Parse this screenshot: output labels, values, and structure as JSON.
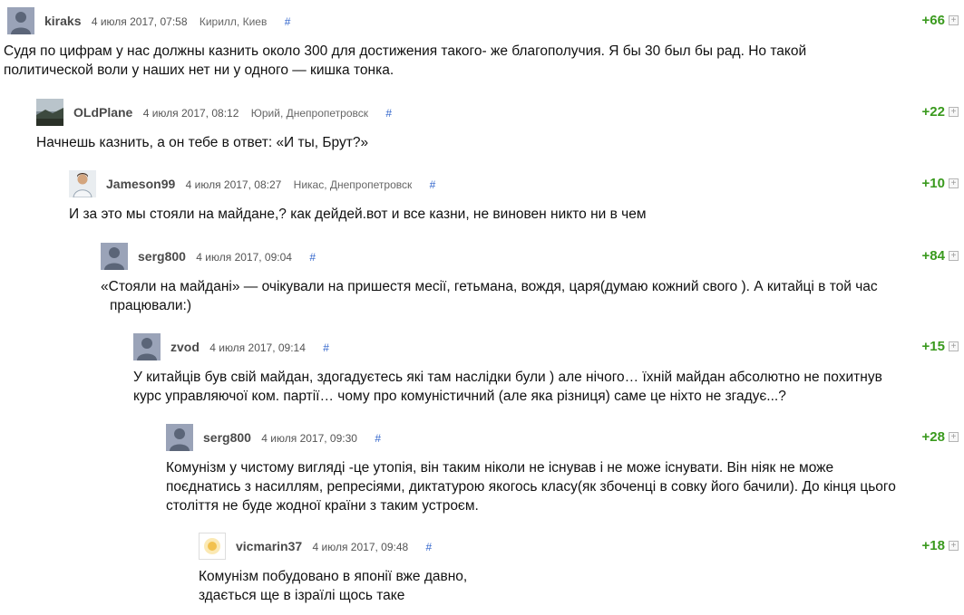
{
  "comments": [
    {
      "author": "kiraks",
      "date": "4 июля 2017, 07:58",
      "location": "Кирилл, Киев",
      "anchor": "#",
      "rating": "+66",
      "vote": "+",
      "avatar_icon": "default-user-avatar",
      "lines": [
        "Судя по цифрам у нас должны казнить около 300 для достижения такого- же благополучия. Я бы 30 был бы рад. Но такой",
        "политической воли у наших нет ни у одного — кишка тонка."
      ]
    },
    {
      "author": "OLdPlane",
      "date": "4 июля 2017, 08:12",
      "location": "Юрий, Днепропетровск",
      "anchor": "#",
      "rating": "+22",
      "vote": "+",
      "avatar_icon": "landscape-photo-avatar",
      "lines": [
        "Начнешь казнить, а он тебе в ответ: «И ты, Брут?»"
      ]
    },
    {
      "author": "Jameson99",
      "date": "4 июля 2017, 08:27",
      "location": "Никас, Днепропетровск",
      "anchor": "#",
      "rating": "+10",
      "vote": "+",
      "avatar_icon": "person-photo-avatar",
      "lines": [
        "И за это мы стояли на майдане,? как дейдей.вот и все казни, не виновен никто ни в чем"
      ]
    },
    {
      "author": "serg800",
      "date": "4 июля 2017, 09:04",
      "location": "",
      "anchor": "#",
      "rating": "+84",
      "vote": "+",
      "avatar_icon": "default-user-avatar",
      "lines": [
        "«Стояли на майдані» — очікували на пришестя месії, гетьмана, вождя, царя(думаю кожний свого ). А китайці в той час",
        "працювали:)"
      ]
    },
    {
      "author": "zvod",
      "date": "4 июля 2017, 09:14",
      "location": "",
      "anchor": "#",
      "rating": "+15",
      "vote": "+",
      "avatar_icon": "default-user-avatar",
      "lines": [
        "У китайців був свій майдан, здогадуєтесь які там наслідки були ) але нічого… їхній майдан абсолютно не похитнув",
        "курс управляючої ком. партії… чому про комуністичний (але яка різниця) саме це ніхто не згадує...?"
      ]
    },
    {
      "author": "serg800",
      "date": "4 июля 2017, 09:30",
      "location": "",
      "anchor": "#",
      "rating": "+28",
      "vote": "+",
      "avatar_icon": "default-user-avatar",
      "lines": [
        "Комунізм у чистому вигляді -це утопія, він таким ніколи не існував і не може існувати. Він ніяк не може",
        "поєднатись з насиллям, репресіями, диктатурою якогось класу(як збоченці в совку його бачили). До кінця цього",
        "століття не буде жодної країни з таким устроєм."
      ]
    },
    {
      "author": "vicmarin37",
      "date": "4 июля 2017, 09:48",
      "location": "",
      "anchor": "#",
      "rating": "+18",
      "vote": "+",
      "avatar_icon": "sun-avatar",
      "lines": [
        "Комунізм побудовано в японії вже давно,",
        "здається ще в ізраїлі щось таке"
      ]
    }
  ]
}
